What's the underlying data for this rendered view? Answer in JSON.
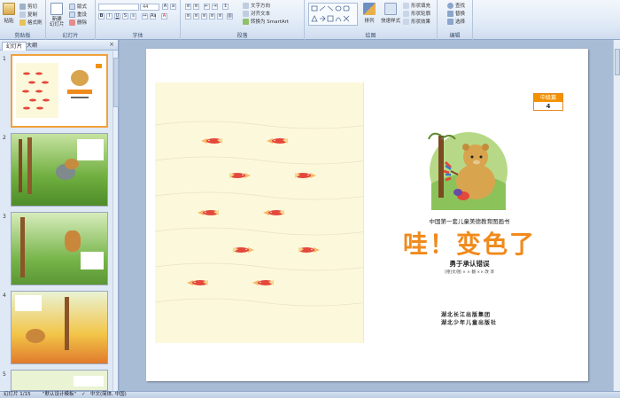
{
  "ribbon": {
    "clipboard": {
      "label": "剪贴板",
      "paste": "粘贴",
      "cut": "剪切",
      "copy": "复制",
      "format": "格式刷"
    },
    "slides": {
      "label": "幻灯片",
      "new_slide": "新建\n幻灯片",
      "layout": "版式",
      "reset": "重设",
      "delete": "删除"
    },
    "font": {
      "label": "字体",
      "font_name": "",
      "font_size": "44"
    },
    "paragraph": {
      "label": "段落",
      "text_direction": "文字方向",
      "align_text": "对齐文本",
      "smartart": "转换为 SmartArt"
    },
    "drawing": {
      "label": "绘图",
      "arrange": "排列",
      "quick_styles": "快速样式",
      "shape_fill": "形状填充",
      "shape_outline": "形状轮廓",
      "shape_effects": "形状效果"
    },
    "editing": {
      "label": "编辑",
      "find": "查找",
      "replace": "替换",
      "select": "选择"
    }
  },
  "panel": {
    "tab_slides": "幻灯片",
    "tab_outline": "大纲",
    "close": "×",
    "thumb_numbers": [
      "1",
      "2",
      "3",
      "4",
      "5"
    ]
  },
  "slide": {
    "badge_top": "中级篇",
    "badge_num": "4",
    "series": "中国第一套儿童美德教育图画书",
    "title": "哇！变色了",
    "subtitle": "勇于承认错误",
    "credits": "[德]文/图  × × 翻  ×× 改  译",
    "publisher": "湖北长江出版集团\n湖北少年儿童出版社"
  },
  "status": {
    "slide_count": "幻灯片 1/15",
    "theme": "\"默认设计模板\"",
    "language": "中文(简体, 中国)"
  },
  "colors": {
    "accent": "#f08a1c",
    "ribbon_bg": "#dde8f6",
    "selection": "#f2a13a"
  }
}
